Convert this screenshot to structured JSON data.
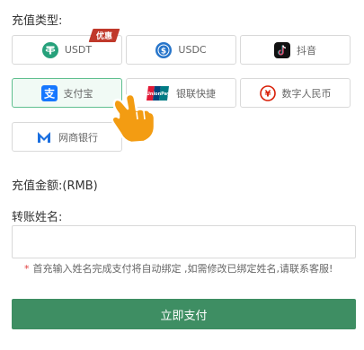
{
  "recharge_type_label": "充值类型:",
  "badge_label": "优惠",
  "payment_methods": [
    {
      "label": "USDT",
      "icon": "tether-icon"
    },
    {
      "label": "USDC",
      "icon": "usdc-icon"
    },
    {
      "label": "抖音",
      "icon": "tiktok-icon"
    },
    {
      "label": "支付宝",
      "icon": "alipay-icon"
    },
    {
      "label": "银联快捷",
      "icon": "unionpay-icon"
    },
    {
      "label": "数字人民币",
      "icon": "digital-rmb-icon"
    },
    {
      "label": "网商银行",
      "icon": "mybank-icon"
    }
  ],
  "selected_method": "支付宝",
  "amount_label": "充值金额:(RMB)",
  "name_label": "转账姓名:",
  "name_input": {
    "value": "",
    "placeholder": ""
  },
  "hint": {
    "star": "*",
    "text": "首充输入姓名完成支付将自动绑定 ,如需修改已绑定姓名,请联系客服!"
  },
  "submit_label": "立即支付",
  "colors": {
    "accent_green": "#3e8e63",
    "selected_border": "#5fbf8f",
    "badge_red": "#c0392b",
    "tether_green": "#26a17b",
    "usdc_blue": "#2775ca",
    "alipay_blue": "#1677ff",
    "rmb_red": "#d81e06",
    "mybank_blue": "#1a6fe0",
    "pointer_orange": "#f39c12"
  }
}
